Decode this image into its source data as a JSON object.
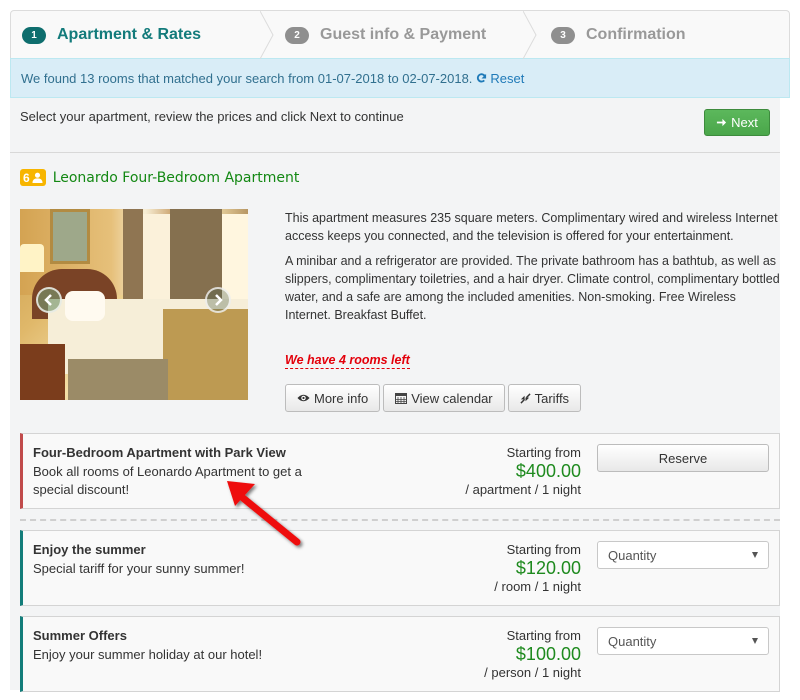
{
  "steps": [
    {
      "number": "1",
      "label": "Apartment & Rates",
      "active": true
    },
    {
      "number": "2",
      "label": "Guest info & Payment",
      "active": false
    },
    {
      "number": "3",
      "label": "Confirmation",
      "active": false
    }
  ],
  "search_alert": {
    "message": "We found 13 rooms that matched your search from 01-07-2018 to 02-07-2018.",
    "reset_label": "Reset",
    "reset_icon": "refresh-icon"
  },
  "toolbar": {
    "instruction": "Select your apartment, review the prices and click Next to continue",
    "next_label": "Next",
    "next_icon": "arrow-right-icon"
  },
  "apartment": {
    "capacity": "6",
    "capacity_icon": "user-icon",
    "name": "Leonardo Four-Bedroom Apartment",
    "description": [
      "This apartment measures 235 square meters. Complimentary wired and wireless Internet access keeps you connected, and the television is offered for your entertainment.",
      "A minibar and a refrigerator are provided. The private bathroom has a bathtub, as well as slippers, complimentary toiletries, and a hair dryer. Climate control, complimentary bottled water, and a safe are among the included amenities. Non-smoking. Free Wireless Internet. Breakfast Buffet."
    ],
    "availability_note": "We have 4 rooms left",
    "actions": [
      {
        "label": "More info",
        "icon": "eye-icon"
      },
      {
        "label": "View calendar",
        "icon": "calendar-icon"
      },
      {
        "label": "Tariffs",
        "icon": "compress-icon"
      }
    ]
  },
  "tariffs": [
    {
      "name": "Four-Bedroom Apartment with Park View",
      "description": "Book all rooms of Leonardo Apartment to get a special discount!",
      "starting_from_label": "Starting from",
      "price": "$400.00",
      "unit": "/ apartment / 1 night",
      "action_label": "Reserve",
      "accent": "#c14b4b"
    },
    {
      "name": "Enjoy the summer",
      "description": "Special tariff for your sunny summer!",
      "starting_from_label": "Starting from",
      "price": "$120.00",
      "unit": "/ room / 1 night",
      "select_placeholder": "Quantity",
      "accent": "#137d7a"
    },
    {
      "name": "Summer Offers",
      "description": "Enjoy your summer holiday at our hotel!",
      "starting_from_label": "Starting from",
      "price": "$100.00",
      "unit": "/ person / 1 night",
      "select_placeholder": "Quantity",
      "accent": "#137d7a"
    }
  ],
  "colors": {
    "primary": "#137b7b",
    "success": "#5cb85c",
    "price": "#1e8a1e",
    "alert_bg": "#d9edf7",
    "warning_text": "#e3000b",
    "capacity_badge": "#f7b500"
  }
}
